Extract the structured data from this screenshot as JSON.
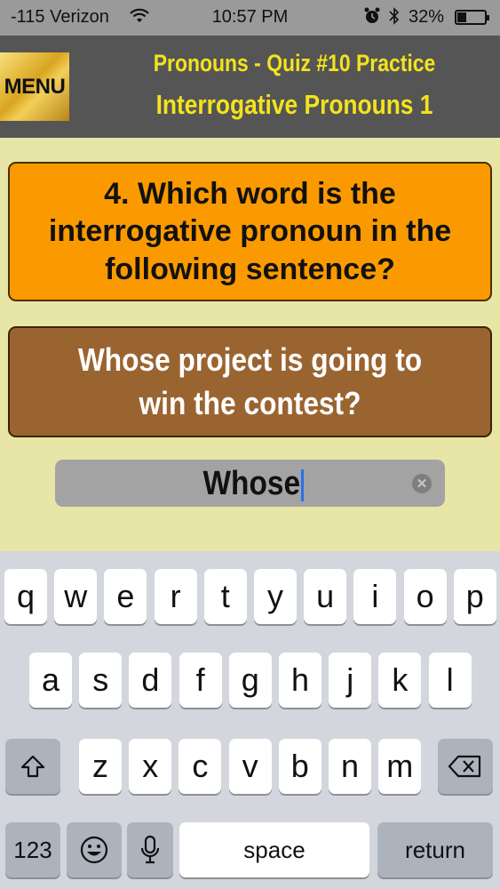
{
  "status_bar": {
    "carrier": "-115 Verizon",
    "time": "10:57 PM",
    "battery_percent": "32%",
    "battery_level": 0.32,
    "icons": [
      "wifi-icon",
      "alarm-icon",
      "bluetooth-icon",
      "battery-icon"
    ]
  },
  "header": {
    "menu_label": "MENU",
    "title": "Pronouns - Quiz #10 Practice",
    "subtitle": "Interrogative Pronouns 1"
  },
  "quiz": {
    "question": "4. Which word is the interrogative pronoun in the following sentence?",
    "sentence": "Whose project is going to win the contest?",
    "answer_value": "Whose"
  },
  "colors": {
    "background": "#e8e6a6",
    "header": "#555555",
    "title": "#f3e31f",
    "question_card": "#fb9a00",
    "sentence_card": "#9a6431",
    "caret": "#2a6fe8"
  },
  "keyboard": {
    "row1": [
      "q",
      "w",
      "e",
      "r",
      "t",
      "y",
      "u",
      "i",
      "o",
      "p"
    ],
    "row2": [
      "a",
      "s",
      "d",
      "f",
      "g",
      "h",
      "j",
      "k",
      "l"
    ],
    "row3": [
      "z",
      "x",
      "c",
      "v",
      "b",
      "n",
      "m"
    ],
    "numbers_label": "123",
    "space_label": "space",
    "return_label": "return"
  }
}
